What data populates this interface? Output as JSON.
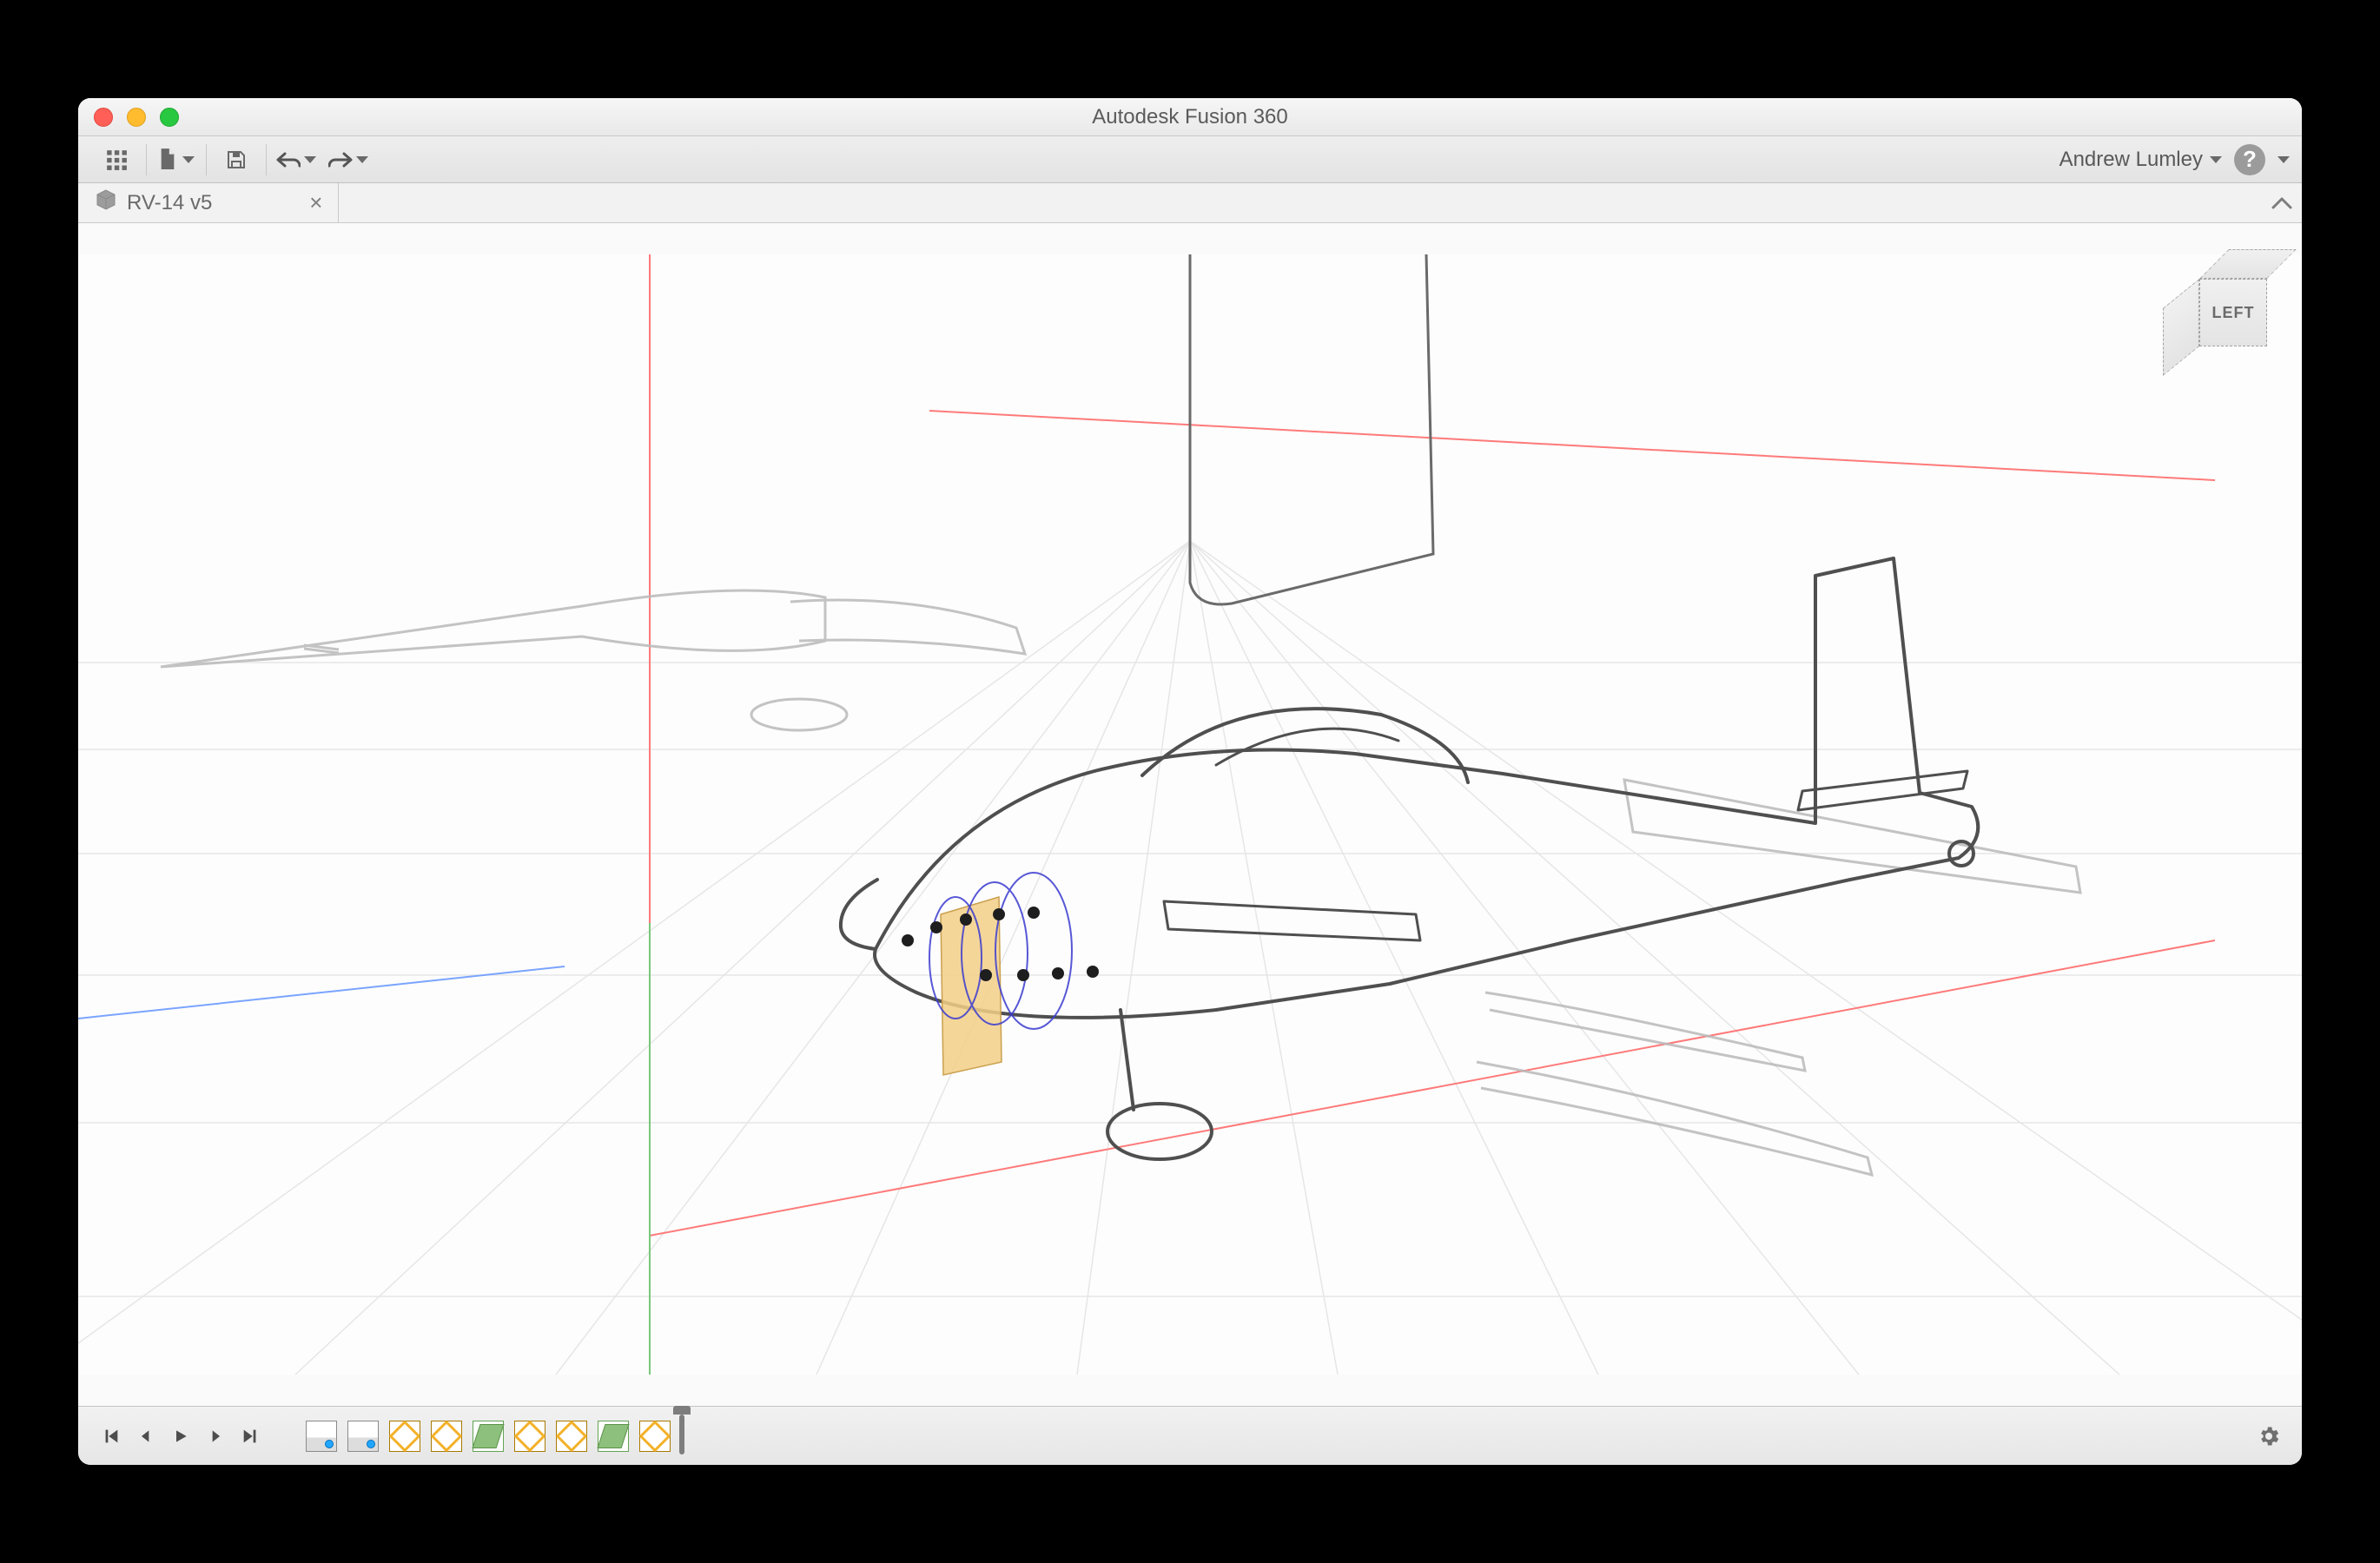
{
  "window": {
    "title": "Autodesk Fusion 360"
  },
  "toolbar": {
    "user_name": "Andrew Lumley"
  },
  "tabs": [
    {
      "label": "RV-14 v5"
    }
  ],
  "viewcube": {
    "front_face_label": "LEFT"
  },
  "timeline": {
    "icons": [
      "img",
      "img",
      "sk",
      "sk",
      "pl",
      "sk",
      "sk",
      "pl",
      "sk"
    ]
  }
}
